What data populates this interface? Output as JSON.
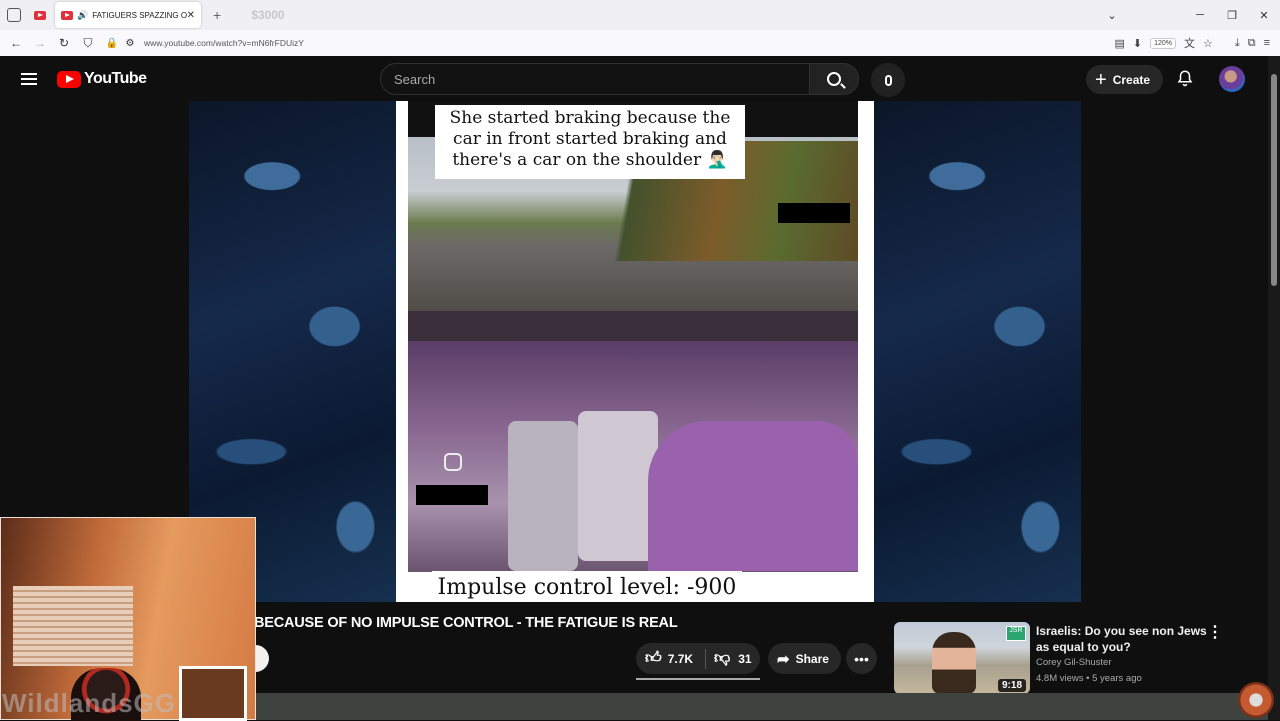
{
  "browser": {
    "tab_title": "FATIGUERS SPAZZING OUT",
    "ghost_tab": "$3000",
    "url": "www.youtube.com/watch?v=mN6frFDUizY",
    "zoom": "120%"
  },
  "header": {
    "logo": "YouTube",
    "search_placeholder": "Search",
    "create_label": "Create"
  },
  "video": {
    "caption": "She started braking because the car in front started braking and there's a car on the shoulder 🤦🏻‍♂️",
    "overlay": "Impulse control level: -900",
    "title": "BECAUSE OF NO IMPULSE CONTROL - THE FATIGUE IS REAL",
    "likes": "7.7K",
    "dislikes": "31",
    "share_label": "Share"
  },
  "recommended": {
    "title": "Israelis: Do you see non Jews as equal to you?",
    "channel": "Corey Gil-Shuster",
    "meta": "4.8M views • 5 years ago",
    "duration": "9:18",
    "badge": "JSR"
  },
  "stream": {
    "watermark": "WildlandsGG"
  },
  "colors": {
    "brand_red": "#ff0000",
    "bg": "#0f0f0f",
    "chip": "#272727"
  }
}
